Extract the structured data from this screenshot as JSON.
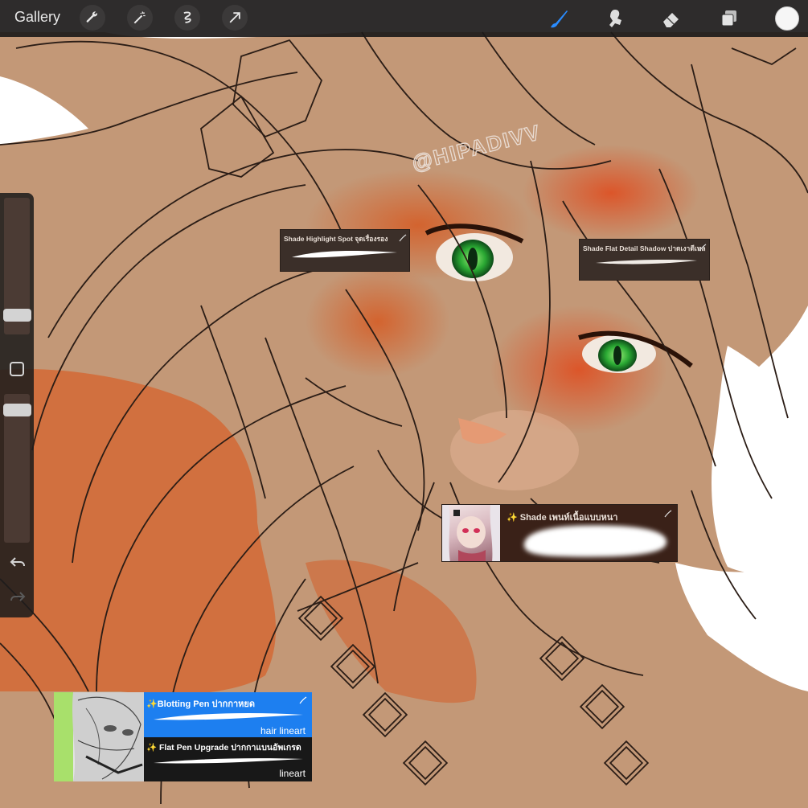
{
  "toolbar": {
    "gallery_label": "Gallery",
    "tools_left": [
      "wrench-icon",
      "magic-wand-icon",
      "selection-icon",
      "transform-arrow-icon"
    ],
    "tools_right": [
      "brush-icon",
      "smudge-icon",
      "eraser-icon",
      "layers-icon"
    ],
    "active_tool": "brush-icon",
    "active_color": "#f4f4f4"
  },
  "sidebar": {
    "brush_size_level": 0.27,
    "opacity_level": 0.95,
    "modify_icon": "square-icon",
    "undo_icon": "undo-arrow-icon",
    "redo_icon": "redo-arrow-icon"
  },
  "artwork": {
    "watermark": "@HIPADIVV",
    "skin_color": "#c59a79",
    "shade_color": "#d26633",
    "eye_color": "#3cb73a"
  },
  "brush_cards": {
    "highlight_spot": {
      "title": "Shade Highlight Spot จุดเรื่องรอง"
    },
    "flat_detail": {
      "title": "Shade Flat Detail Shadow ปาดเงาดีเทล"
    },
    "thick_paint": {
      "title": "✨ Shade เพนท์เนื้อแบบหนา"
    },
    "blotting_pen": {
      "title": "✨Blotting Pen ปากกาหยด",
      "tag": "hair lineart",
      "accent": "#1d7ff0"
    },
    "flat_pen": {
      "title": "✨ Flat Pen Upgrade ปากกาแบนอัพเกรด",
      "tag": "lineart"
    }
  }
}
